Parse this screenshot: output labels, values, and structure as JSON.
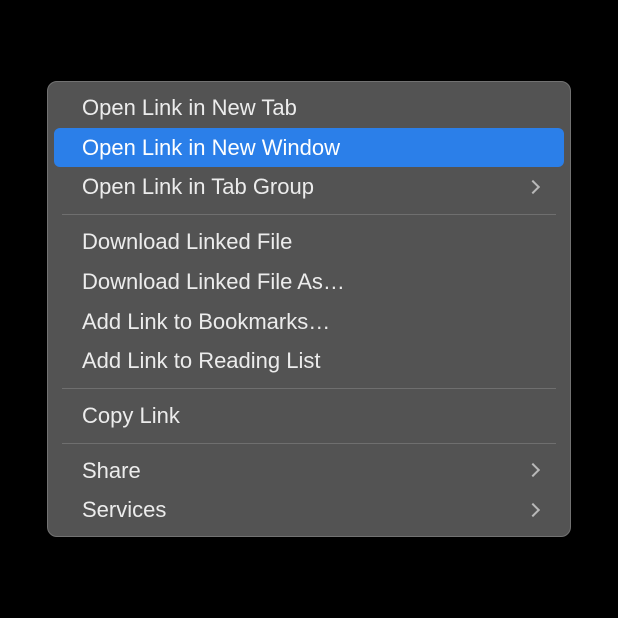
{
  "menu": {
    "groups": [
      {
        "items": [
          {
            "label": "Open Link in New Tab",
            "submenu": false,
            "highlighted": false
          },
          {
            "label": "Open Link in New Window",
            "submenu": false,
            "highlighted": true
          },
          {
            "label": "Open Link in Tab Group",
            "submenu": true,
            "highlighted": false
          }
        ]
      },
      {
        "items": [
          {
            "label": "Download Linked File",
            "submenu": false,
            "highlighted": false
          },
          {
            "label": "Download Linked File As…",
            "submenu": false,
            "highlighted": false
          },
          {
            "label": "Add Link to Bookmarks…",
            "submenu": false,
            "highlighted": false
          },
          {
            "label": "Add Link to Reading List",
            "submenu": false,
            "highlighted": false
          }
        ]
      },
      {
        "items": [
          {
            "label": "Copy Link",
            "submenu": false,
            "highlighted": false
          }
        ]
      },
      {
        "items": [
          {
            "label": "Share",
            "submenu": true,
            "highlighted": false
          },
          {
            "label": "Services",
            "submenu": true,
            "highlighted": false
          }
        ]
      }
    ]
  }
}
